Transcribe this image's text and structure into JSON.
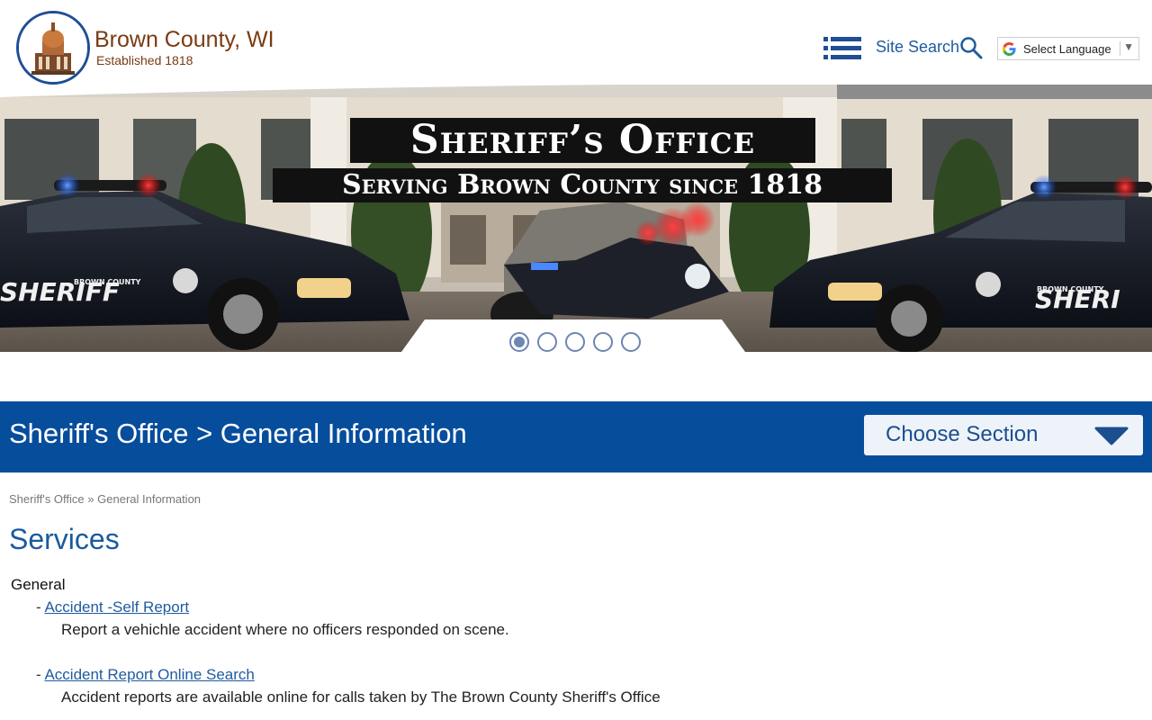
{
  "header": {
    "brand_name": "Brown County, WI",
    "brand_established": "Established 1818",
    "site_search_label": "Site Search",
    "language_label": "Select Language",
    "language_arrow": "▼"
  },
  "hero": {
    "title": "Sheriff’s Office",
    "subtitle": "Serving Brown County since 1818",
    "slide_count": 5,
    "active_slide": 1,
    "car_left_text": "SHERIFF",
    "car_left_small": "BROWN COUNTY",
    "car_right_text": "SHERI",
    "car_right_small": "BROWN COUNTY"
  },
  "section": {
    "title": "Sheriff's Office > General Information",
    "choose_label": "Choose Section"
  },
  "breadcrumb": {
    "items": [
      "Sheriff's Office",
      "General Information"
    ],
    "separator": "»"
  },
  "content": {
    "heading": "Services",
    "group_label": "General",
    "services": [
      {
        "prefix": "- ",
        "link": "Accident -Self Report",
        "description": "Report a vehichle accident where no officers responded on scene."
      },
      {
        "prefix": "- ",
        "link": "Accident Report Online Search",
        "description": "Accident reports are available online for calls taken by The Brown County Sheriff's Office"
      }
    ]
  },
  "colors": {
    "brand": "#7a3b12",
    "accent_blue": "#064d9c",
    "link_blue": "#1f5b9f",
    "dot": "#6e86b3"
  }
}
